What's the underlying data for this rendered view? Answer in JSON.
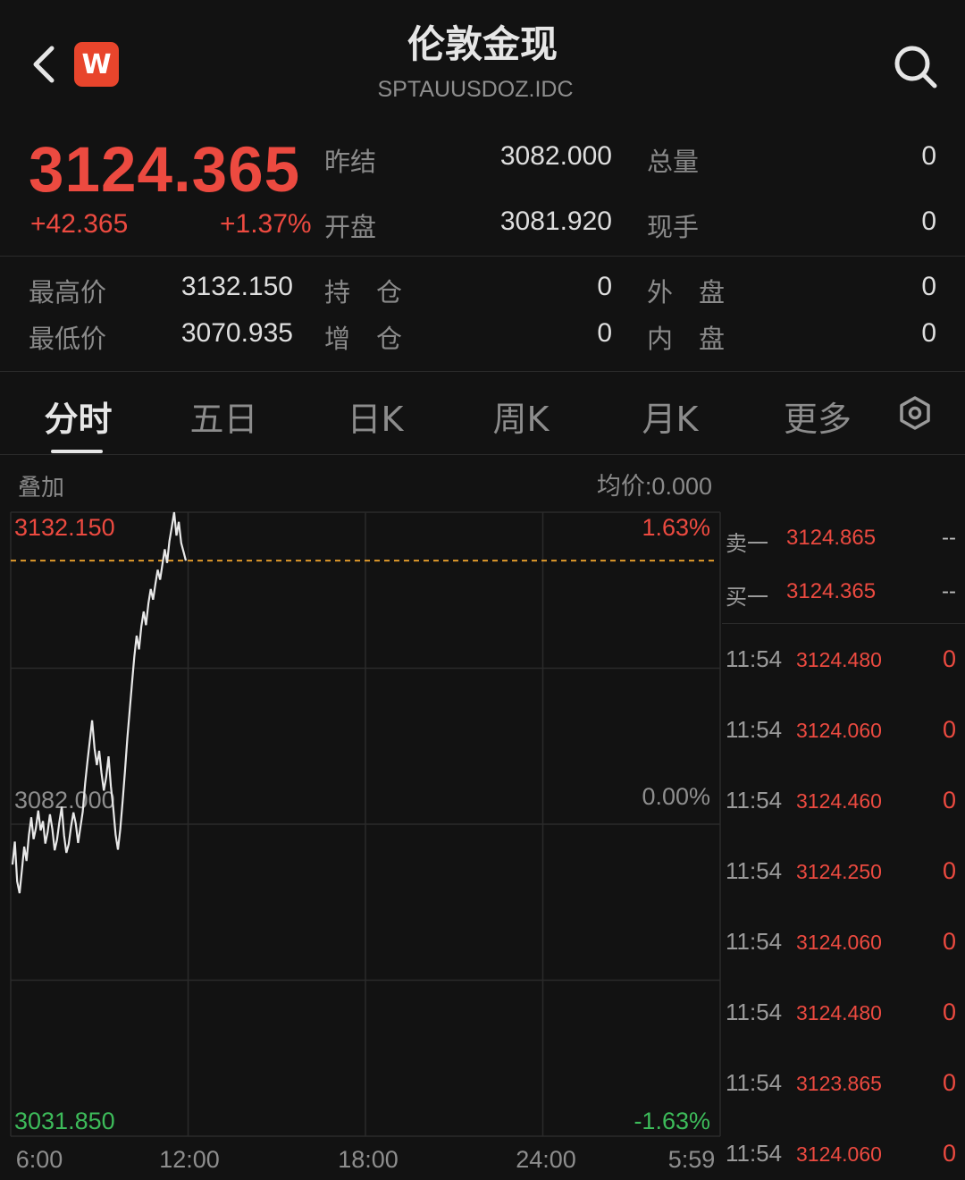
{
  "header": {
    "title": "伦敦金现",
    "code": "SPTAUUSDOZ.IDC",
    "logo_text": "W"
  },
  "quote": {
    "price": "3124.365",
    "change": "+42.365",
    "change_pct": "+1.37%",
    "prev_close_label": "昨结",
    "prev_close": "3082.000",
    "open_label": "开盘",
    "open": "3081.920",
    "total_vol_label": "总量",
    "total_vol": "0",
    "current_hand_label": "现手",
    "current_hand": "0",
    "high_label": "最高价",
    "high": "3132.150",
    "low_label": "最低价",
    "low": "3070.935",
    "open_interest_label": "持　仓",
    "open_interest": "0",
    "oi_change_label": "增　仓",
    "oi_change": "0",
    "outer_label": "外　盘",
    "outer": "0",
    "inner_label": "内　盘",
    "inner": "0"
  },
  "tabs": [
    "分时",
    "五日",
    "日K",
    "周K",
    "月K",
    "更多"
  ],
  "chart_header": {
    "overlay_label": "叠加",
    "avg_price": "均价:0.000"
  },
  "chart_data": {
    "type": "line",
    "ylim": [
      3031.85,
      3132.15
    ],
    "y_tick_labels": {
      "top": "3132.150",
      "mid": "3082.000",
      "bottom": "3031.850"
    },
    "pct_labels": {
      "top": "1.63%",
      "mid": "0.00%",
      "bottom": "-1.63%"
    },
    "x_tick_labels": [
      "6:00",
      "12:00",
      "18:00",
      "24:00",
      "5:59"
    ],
    "current_price_line": 3124.365,
    "series": [
      {
        "values": [
          3075.5,
          3079.2,
          3072.8,
          3070.9,
          3074.6,
          3078.4,
          3076.1,
          3080.3,
          3083.1,
          3079.6,
          3081.4,
          3084.2,
          3081.0,
          3082.5,
          3078.9,
          3080.7,
          3083.6,
          3081.2,
          3077.8,
          3079.5,
          3082.3,
          3084.8,
          3080.2,
          3077.4,
          3078.8,
          3081.6,
          3083.9,
          3082.1,
          3079.0,
          3081.5,
          3084.0,
          3088.6,
          3092.1,
          3095.4,
          3098.7,
          3094.2,
          3091.5,
          3093.8,
          3090.2,
          3087.4,
          3089.6,
          3092.9,
          3088.1,
          3084.7,
          3080.3,
          3077.9,
          3081.2,
          3085.6,
          3090.4,
          3095.8,
          3100.2,
          3104.6,
          3108.9,
          3112.3,
          3110.1,
          3113.8,
          3116.2,
          3114.0,
          3117.5,
          3119.8,
          3118.1,
          3120.6,
          3122.9,
          3121.3,
          3123.8,
          3126.2,
          3124.0,
          3127.5,
          3129.8,
          3132.15,
          3128.4,
          3130.6,
          3127.2,
          3125.8,
          3124.365
        ]
      }
    ]
  },
  "order_book": [
    {
      "label": "卖一",
      "price": "3124.865",
      "vol": "--"
    },
    {
      "label": "买一",
      "price": "3124.365",
      "vol": "--"
    }
  ],
  "trades": [
    {
      "time": "11:54",
      "price": "3124.480",
      "vol": "0"
    },
    {
      "time": "11:54",
      "price": "3124.060",
      "vol": "0"
    },
    {
      "time": "11:54",
      "price": "3124.460",
      "vol": "0"
    },
    {
      "time": "11:54",
      "price": "3124.250",
      "vol": "0"
    },
    {
      "time": "11:54",
      "price": "3124.060",
      "vol": "0"
    },
    {
      "time": "11:54",
      "price": "3124.480",
      "vol": "0"
    },
    {
      "time": "11:54",
      "price": "3123.865",
      "vol": "0"
    },
    {
      "time": "11:54",
      "price": "3124.060",
      "vol": "0"
    }
  ],
  "colors": {
    "up": "#ec4a40",
    "down": "#3dbb5a",
    "line": "#e8e8e8",
    "dashed": "#e09a2c"
  }
}
